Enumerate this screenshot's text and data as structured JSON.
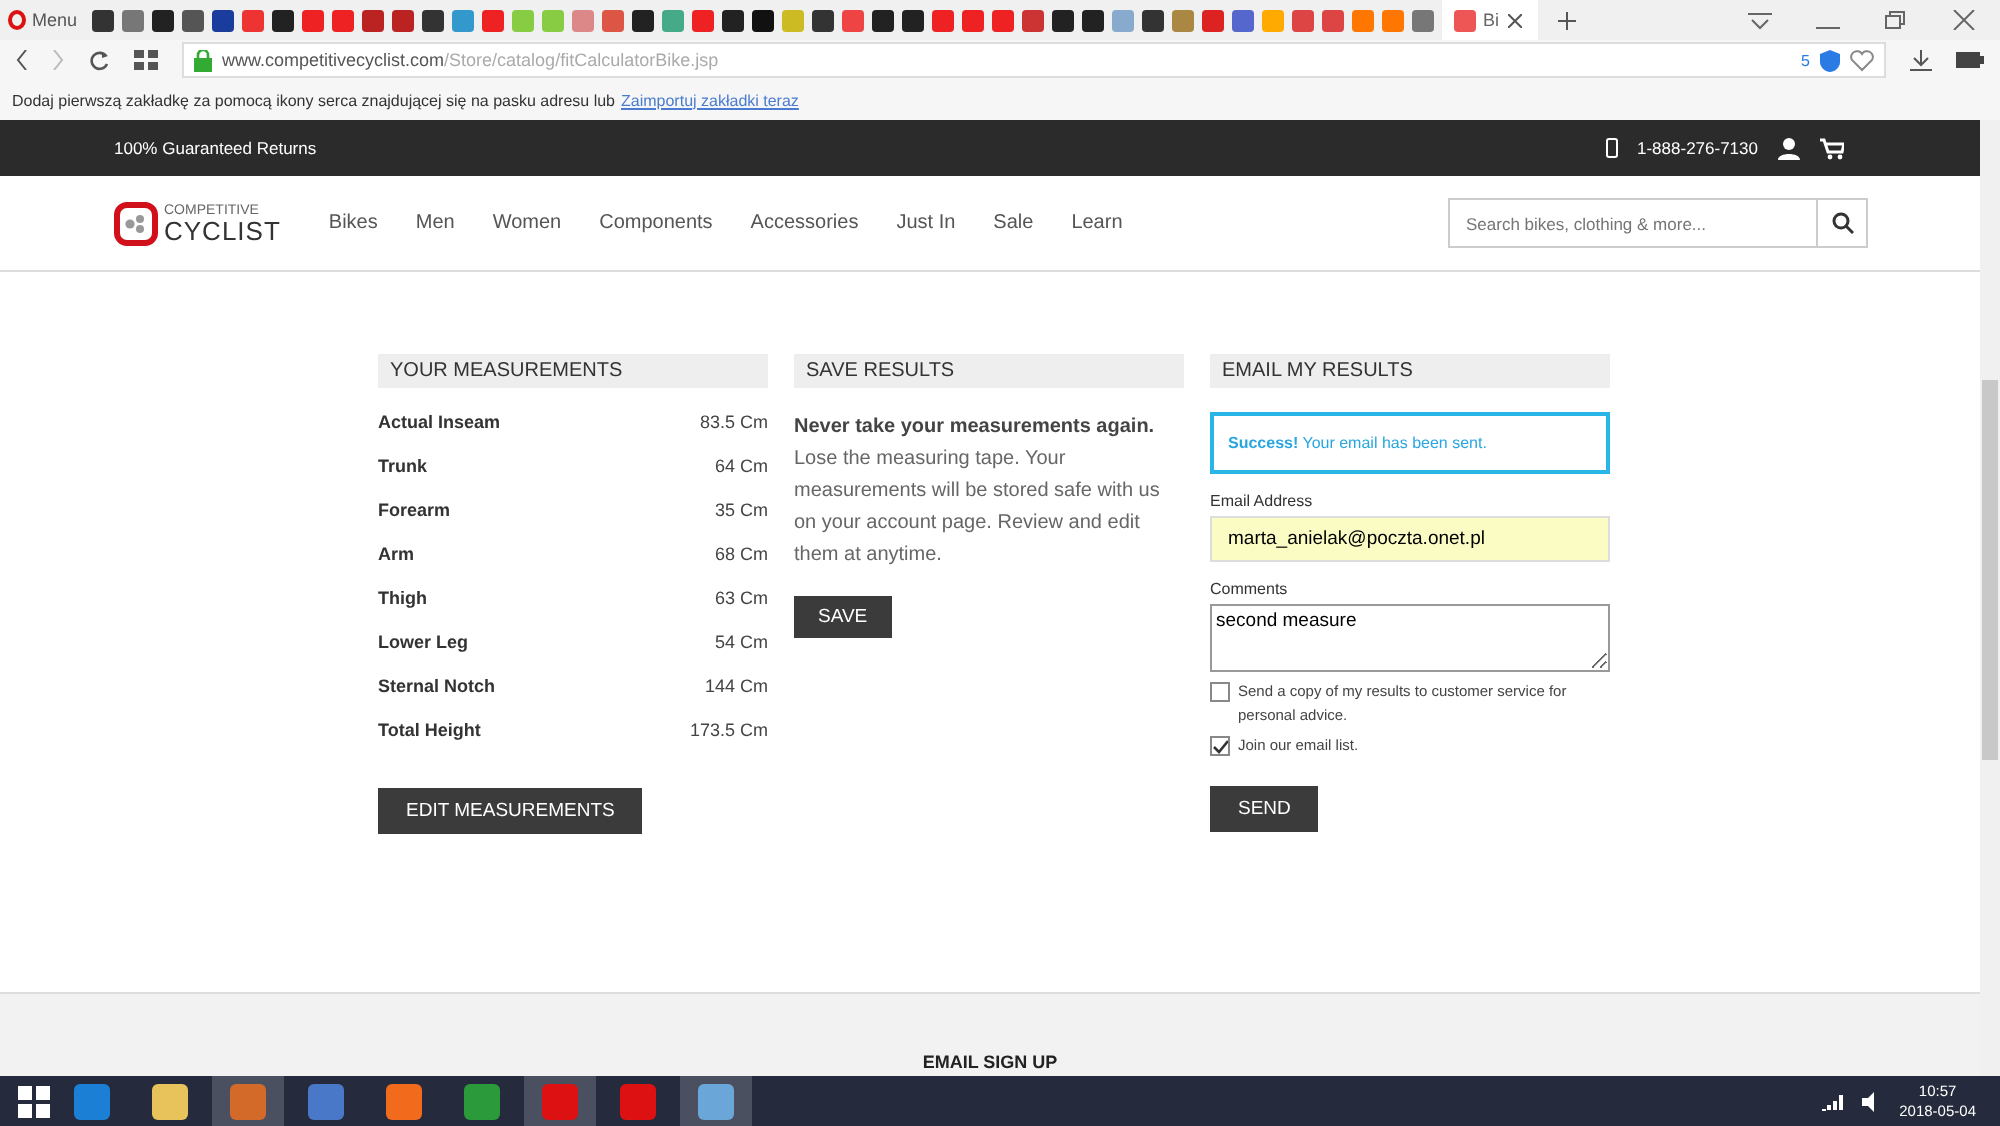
{
  "browser": {
    "menu_label": "Menu",
    "active_tab": {
      "title": "Bi"
    },
    "url_host": "www.competitivecyclist.com",
    "url_path": "/Store/catalog/fitCalculatorBike.jsp",
    "bookmark_hint": "Dodaj pierwszą zakładkę za pomocą ikony serca znajdującej się na pasku adresu lub",
    "bookmark_link": "Zaimportuj zakładki teraz",
    "ext_badge": "5"
  },
  "topbar": {
    "promo": "100% Guaranteed Returns",
    "phone": "1-888-276-7130"
  },
  "logo": {
    "line1": "COMPETITIVE",
    "line2": "CYCLIST"
  },
  "nav": [
    "Bikes",
    "Men",
    "Women",
    "Components",
    "Accessories",
    "Just In",
    "Sale",
    "Learn"
  ],
  "search": {
    "placeholder": "Search bikes, clothing & more..."
  },
  "measurements": {
    "title": "YOUR MEASUREMENTS",
    "rows": [
      {
        "label": "Actual Inseam",
        "value": "83.5 Cm"
      },
      {
        "label": "Trunk",
        "value": "64 Cm"
      },
      {
        "label": "Forearm",
        "value": "35 Cm"
      },
      {
        "label": "Arm",
        "value": "68 Cm"
      },
      {
        "label": "Thigh",
        "value": "63 Cm"
      },
      {
        "label": "Lower Leg",
        "value": "54 Cm"
      },
      {
        "label": "Sternal Notch",
        "value": "144 Cm"
      },
      {
        "label": "Total Height",
        "value": "173.5 Cm"
      }
    ],
    "button": "EDIT MEASUREMENTS"
  },
  "save": {
    "title": "SAVE RESULTS",
    "text": "**Never take your measurements again.** Lose the measuring tape. Your measurements will be stored safe with us on your account page. Review and edit them at anytime.",
    "button": "SAVE"
  },
  "email": {
    "title": "EMAIL MY RESULTS",
    "success": "**Success!** Your email has been sent.",
    "email_label": "Email Address",
    "email_value": "marta_anielak@poczta.onet.pl",
    "comments_label": "Comments",
    "comments_value": "second measure",
    "options": [
      {
        "label": "Send a copy of my results to customer service for personal advice.",
        "checked": false
      },
      {
        "label": "Join our email list.",
        "checked": true
      }
    ],
    "button": "SEND"
  },
  "footer": {
    "heading": "EMAIL SIGN UP"
  },
  "taskbar": {
    "time": "10:57",
    "date": "2018-05-04"
  }
}
